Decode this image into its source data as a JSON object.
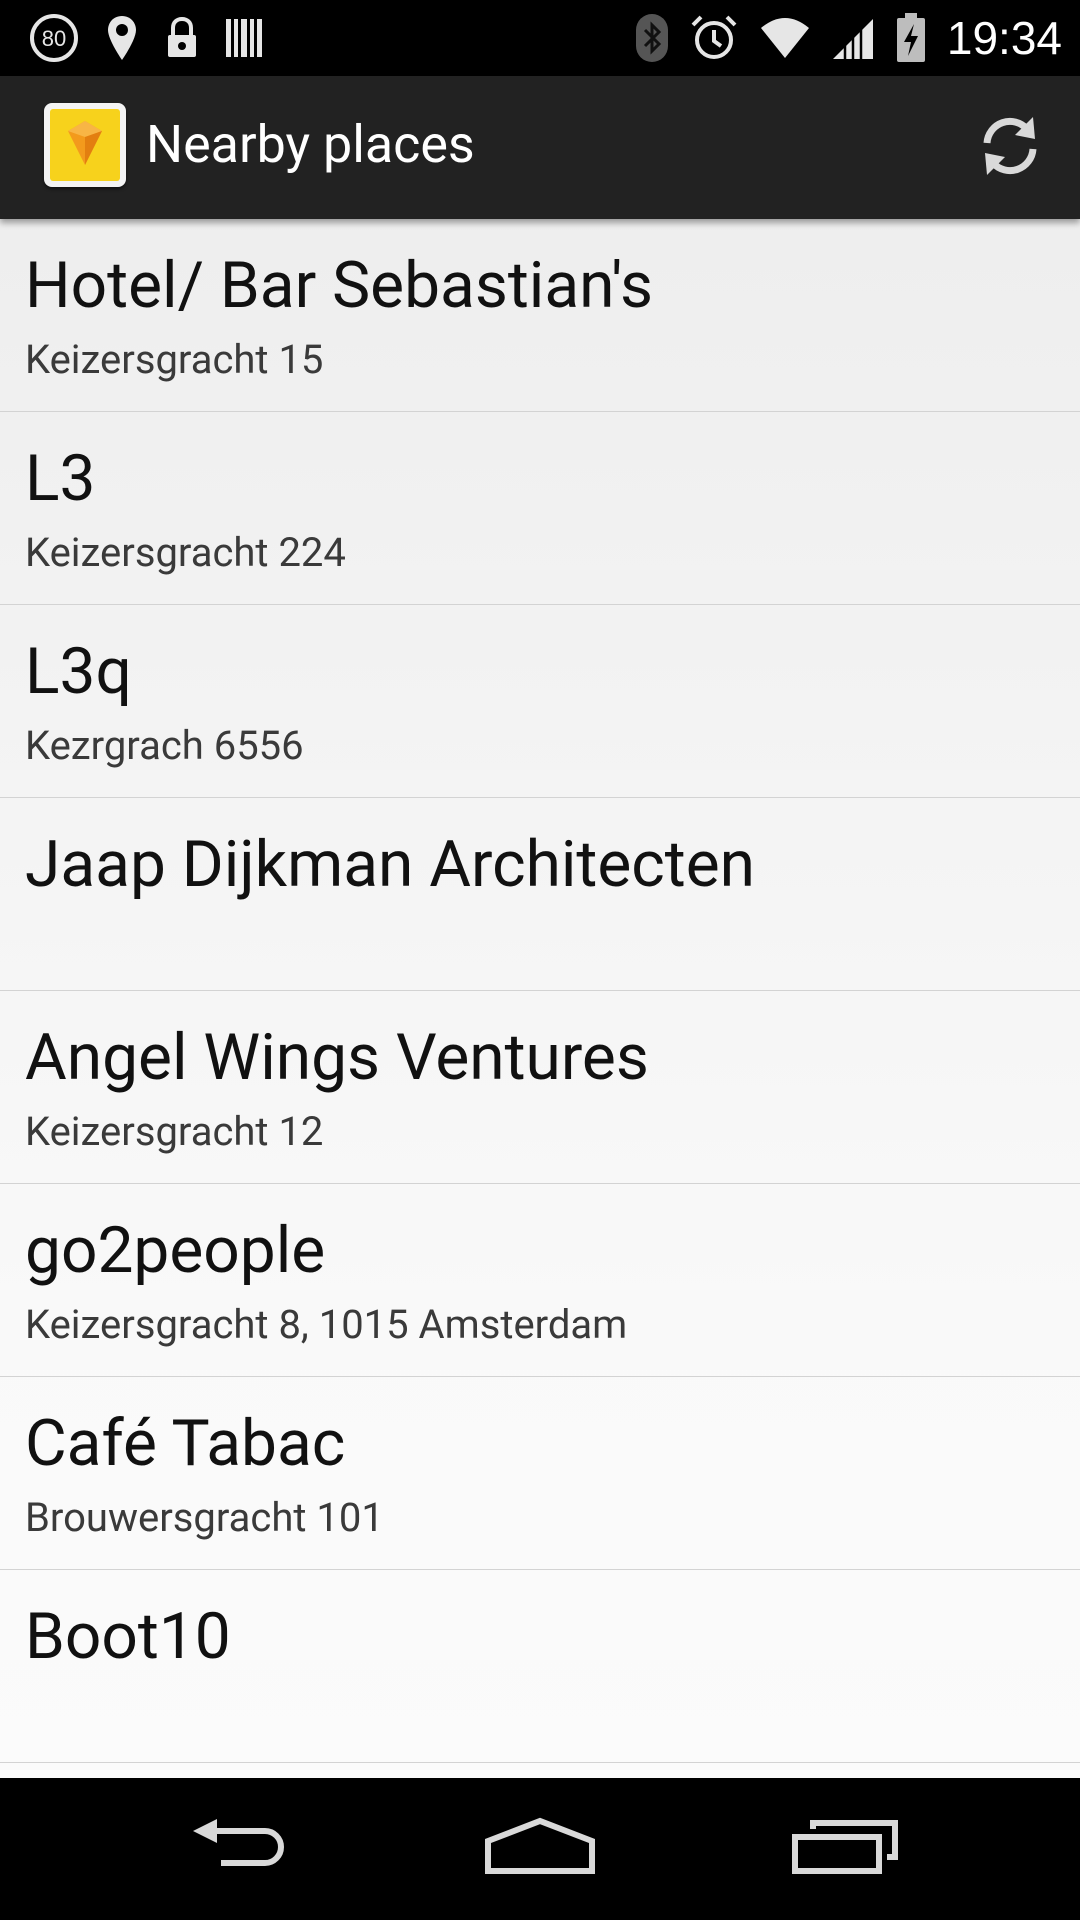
{
  "status_bar": {
    "notification_badge": "80",
    "time": "19:34",
    "icons": [
      "notification-80-icon",
      "location-pin-icon",
      "lock-icon",
      "barcode-icon",
      "bluetooth-icon",
      "alarm-icon",
      "wifi-icon",
      "cell-signal-icon",
      "battery-charging-icon"
    ]
  },
  "action_bar": {
    "title": "Nearby places",
    "app_icon": "app-logo-icon",
    "refresh_icon": "refresh-icon"
  },
  "places": [
    {
      "name": "Hotel/ Bar Sebastian's",
      "address": "Keizersgracht 15"
    },
    {
      "name": "L3",
      "address": "Keizersgracht 224"
    },
    {
      "name": "L3q",
      "address": "Kezrgrach 6556"
    },
    {
      "name": "Jaap Dijkman Architecten",
      "address": ""
    },
    {
      "name": "Angel Wings Ventures",
      "address": "Keizersgracht 12"
    },
    {
      "name": "go2people",
      "address": "Keizersgracht 8, 1015 Amsterdam"
    },
    {
      "name": "Café Tabac",
      "address": "Brouwersgracht 101"
    },
    {
      "name": "Boot10",
      "address": ""
    }
  ],
  "nav_bar": {
    "back": "back-icon",
    "home": "home-icon",
    "recents": "recents-icon"
  },
  "colors": {
    "status_bar_bg": "#000000",
    "action_bar_bg": "#222222",
    "list_bg": "#f2f2f2",
    "app_icon_accent": "#f7d21c",
    "app_icon_gem": "#f39a1c"
  }
}
